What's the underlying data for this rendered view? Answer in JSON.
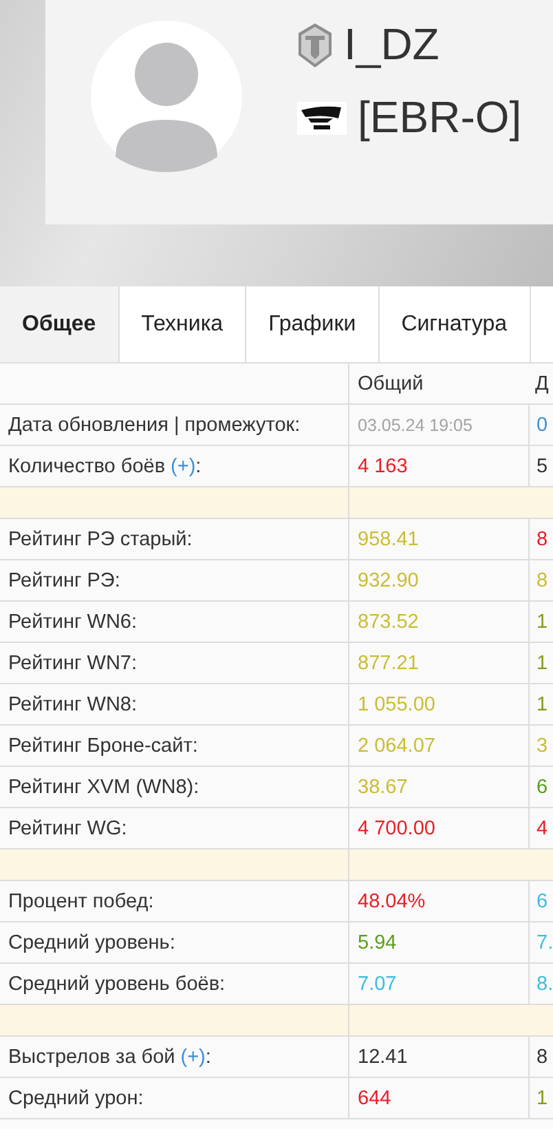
{
  "profile": {
    "name": "I_DZ",
    "clan": "[EBR-O]"
  },
  "tabs": [
    {
      "label": "Общее",
      "selected": true
    },
    {
      "label": "Техника",
      "selected": false
    },
    {
      "label": "Графики",
      "selected": false
    },
    {
      "label": "Сигнатура",
      "selected": false
    }
  ],
  "table": {
    "columns": [
      "Общий",
      "Д"
    ],
    "rows": [
      {
        "kind": "data",
        "label": "Дата обновления | промежуток:",
        "cells": [
          {
            "text": "03.05.24 19:05",
            "color": "#a3a3a3"
          },
          {
            "text": "0",
            "color": "#3d8fd6"
          }
        ]
      },
      {
        "kind": "data",
        "label": "Количество боёв",
        "link": "(+)",
        "suffix": ":",
        "cells": [
          {
            "text": "4 163",
            "color": "#ec1c24"
          },
          {
            "text": "5",
            "color": "#333333"
          }
        ]
      },
      {
        "kind": "separator"
      },
      {
        "kind": "data",
        "label": "Рейтинг РЭ старый:",
        "cells": [
          {
            "text": "958.41",
            "color": "#c9bd32"
          },
          {
            "text": "8",
            "color": "#ec1c24"
          }
        ]
      },
      {
        "kind": "data",
        "label": "Рейтинг РЭ:",
        "cells": [
          {
            "text": "932.90",
            "color": "#c9bd32"
          },
          {
            "text": "8",
            "color": "#c9bd32"
          }
        ]
      },
      {
        "kind": "data",
        "label": "Рейтинг WN6:",
        "cells": [
          {
            "text": "873.52",
            "color": "#c9bd32"
          },
          {
            "text": "1",
            "color": "#8a9a1e"
          }
        ]
      },
      {
        "kind": "data",
        "label": "Рейтинг WN7:",
        "cells": [
          {
            "text": "877.21",
            "color": "#c9bd32"
          },
          {
            "text": "1",
            "color": "#8a9a1e"
          }
        ]
      },
      {
        "kind": "data",
        "label": "Рейтинг WN8:",
        "cells": [
          {
            "text": "1 055.00",
            "color": "#c9bd32"
          },
          {
            "text": "1",
            "color": "#8a9a1e"
          }
        ]
      },
      {
        "kind": "data",
        "label": "Рейтинг Броне-сайт:",
        "cells": [
          {
            "text": "2 064.07",
            "color": "#c9bd32"
          },
          {
            "text": "3",
            "color": "#c9bd32"
          }
        ]
      },
      {
        "kind": "data",
        "label": "Рейтинг XVM (WN8):",
        "cells": [
          {
            "text": "38.67",
            "color": "#c9bd32"
          },
          {
            "text": "6",
            "color": "#5a9e1e"
          }
        ]
      },
      {
        "kind": "data",
        "label": "Рейтинг WG:",
        "cells": [
          {
            "text": "4 700.00",
            "color": "#ec1c24"
          },
          {
            "text": "4",
            "color": "#ec1c24"
          }
        ]
      },
      {
        "kind": "separator"
      },
      {
        "kind": "data",
        "label": "Процент побед:",
        "cells": [
          {
            "text": "48.04%",
            "color": "#ec1c24"
          },
          {
            "text": "6",
            "color": "#3bbde0"
          }
        ]
      },
      {
        "kind": "data",
        "label": "Средний уровень:",
        "cells": [
          {
            "text": "5.94",
            "color": "#5a9e1e"
          },
          {
            "text": "7.",
            "color": "#3bbde0"
          }
        ]
      },
      {
        "kind": "data",
        "label": "Средний уровень боёв:",
        "cells": [
          {
            "text": "7.07",
            "color": "#3bbde0"
          },
          {
            "text": "8.",
            "color": "#3bbde0"
          }
        ]
      },
      {
        "kind": "separator"
      },
      {
        "kind": "data",
        "label": "Выстрелов за бой",
        "link": "(+)",
        "suffix": ":",
        "cells": [
          {
            "text": "12.41",
            "color": "#333333"
          },
          {
            "text": "8",
            "color": "#333333"
          }
        ]
      },
      {
        "kind": "data",
        "label": "Средний урон:",
        "cells": [
          {
            "text": "644",
            "color": "#ec1c24"
          },
          {
            "text": "1",
            "color": "#8a9a1e"
          }
        ]
      }
    ]
  }
}
